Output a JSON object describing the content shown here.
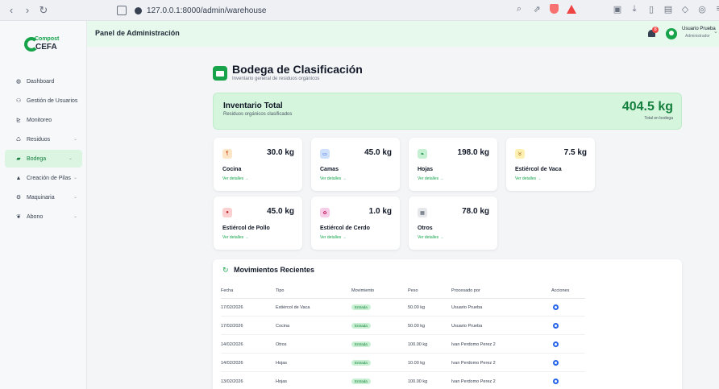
{
  "browser": {
    "url": "127.0.0.1:8000/admin/warehouse"
  },
  "header": {
    "panel_title": "Panel de Administración",
    "notification_count": "8",
    "user_name": "Usuario Prueba",
    "user_role": "Administrador"
  },
  "sidebar": {
    "logo_top": "Compost",
    "logo_bottom": "CEFA",
    "items": [
      {
        "label": "Dashboard",
        "icon": "dashboard-icon",
        "glyph": "◍"
      },
      {
        "label": "Gestión de Usuarios",
        "icon": "users-icon",
        "glyph": "⚇"
      },
      {
        "label": "Monitoreo",
        "icon": "chart-line-icon",
        "glyph": "⊵"
      },
      {
        "label": "Residuos",
        "icon": "recycle-icon",
        "glyph": "♺"
      },
      {
        "label": "Bodega",
        "icon": "warehouse-icon",
        "glyph": "▰"
      },
      {
        "label": "Creación de Pilas",
        "icon": "pile-icon",
        "glyph": "▲"
      },
      {
        "label": "Maquinaria",
        "icon": "machinery-icon",
        "glyph": "⚙"
      },
      {
        "label": "Abono",
        "icon": "seedling-icon",
        "glyph": "❦"
      }
    ]
  },
  "page": {
    "title": "Bodega de Clasificación",
    "subtitle": "Inventario general de residuos orgánicos"
  },
  "total": {
    "label": "Inventario Total",
    "sublabel": "Residuos orgánicos clasificados",
    "value": "404.5 kg",
    "value_sub": "Total en bodega"
  },
  "categories": [
    {
      "name": "Cocina",
      "value": "30.0 kg",
      "link": "Ver detalles →",
      "icon": "utensils-icon",
      "color": "#fde6c7",
      "fg": "#c2410c"
    },
    {
      "name": "Camas",
      "value": "45.0 kg",
      "link": "Ver detalles →",
      "icon": "bed-icon",
      "color": "#cfe0fb",
      "fg": "#1d4ed8"
    },
    {
      "name": "Hojas",
      "value": "198.0 kg",
      "link": "Ver detalles →",
      "icon": "leaf-icon",
      "color": "#c6f0d2",
      "fg": "#15803d"
    },
    {
      "name": "Estiércol de Vaca",
      "value": "7.5 kg",
      "link": "Ver detalles →",
      "icon": "cow-icon",
      "color": "#fdf0b0",
      "fg": "#a16207"
    },
    {
      "name": "Estiércol de Pollo",
      "value": "45.0 kg",
      "link": "Ver detalles →",
      "icon": "egg-icon",
      "color": "#fcd0d0",
      "fg": "#b91c1c"
    },
    {
      "name": "Estiércol de Cerdo",
      "value": "1.0 kg",
      "link": "Ver detalles →",
      "icon": "pig-icon",
      "color": "#f8cde8",
      "fg": "#be185d"
    },
    {
      "name": "Otros",
      "value": "78.0 kg",
      "link": "Ver detalles →",
      "icon": "box-icon",
      "color": "#e5e7eb",
      "fg": "#4b5563"
    }
  ],
  "movements": {
    "title": "Movimientos Recientes",
    "columns": [
      "Fecha",
      "Tipo",
      "Movimiento",
      "Peso",
      "Procesado por",
      "Acciones"
    ],
    "rows": [
      {
        "fecha": "17/02/2026",
        "tipo": "Estiércol de Vaca",
        "movimiento": "Entrada",
        "peso": "50.00 kg",
        "procesado": "Usuario Prueba"
      },
      {
        "fecha": "17/02/2026",
        "tipo": "Cocina",
        "movimiento": "Entrada",
        "peso": "50.00 kg",
        "procesado": "Usuario Prueba"
      },
      {
        "fecha": "14/02/2026",
        "tipo": "Otros",
        "movimiento": "Entrada",
        "peso": "100.00 kg",
        "procesado": "Ivan Perdomo Perez 2"
      },
      {
        "fecha": "14/02/2026",
        "tipo": "Hojas",
        "movimiento": "Entrada",
        "peso": "10.00 kg",
        "procesado": "Ivan Perdomo Perez 2"
      },
      {
        "fecha": "13/02/2026",
        "tipo": "Hojas",
        "movimiento": "Entrada",
        "peso": "100.00 kg",
        "procesado": "Ivan Perdomo Perez 2"
      }
    ]
  }
}
